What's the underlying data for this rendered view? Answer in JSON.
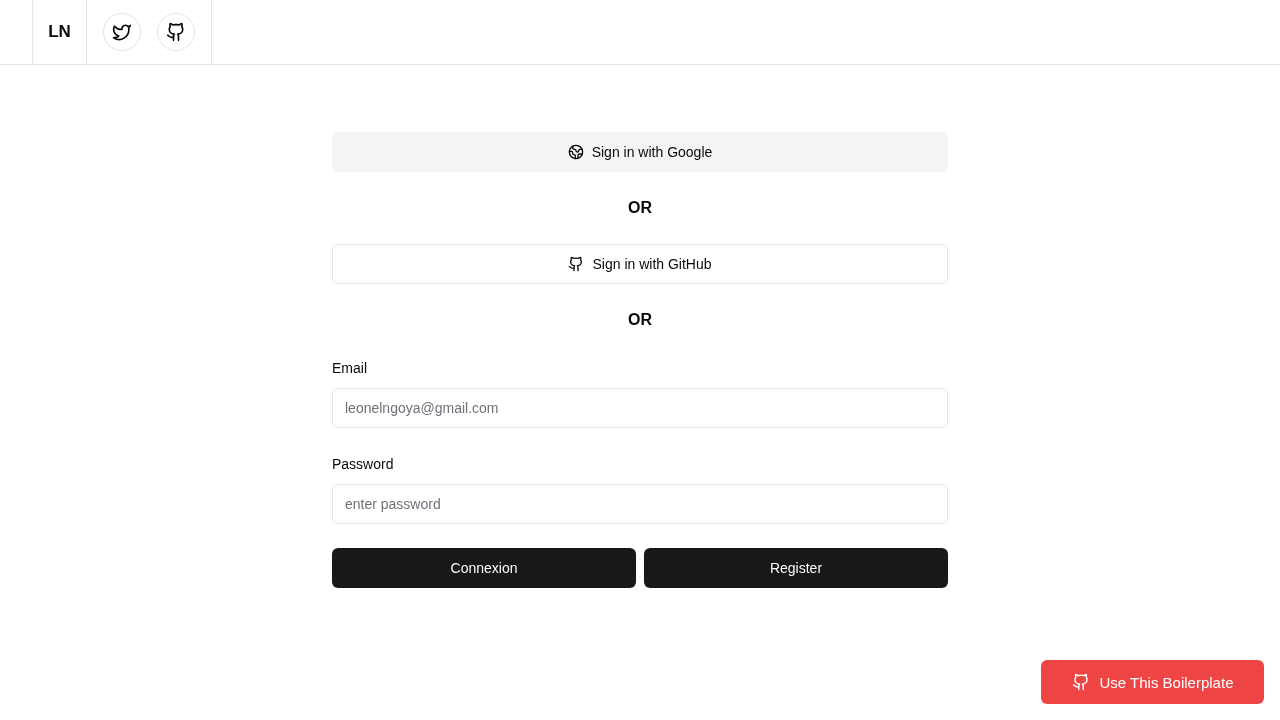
{
  "header": {
    "logo": "LN",
    "social_links": [
      {
        "kind": "twitter"
      },
      {
        "kind": "github"
      }
    ]
  },
  "auth_options": [
    {
      "kind": "google",
      "label": "Sign in with Google"
    },
    {
      "kind": "divider",
      "label": "OR"
    },
    {
      "kind": "github",
      "label": "Sign in with GitHub"
    },
    {
      "kind": "divider",
      "label": "OR"
    }
  ],
  "fields": [
    {
      "label": "Email",
      "placeholder": "leonelngoya@gmail.com"
    },
    {
      "label": "Password",
      "placeholder": "enter password"
    }
  ],
  "actions": [
    "Connexion",
    "Register"
  ],
  "floating_button": {
    "label": "Use This Boilerplate"
  }
}
